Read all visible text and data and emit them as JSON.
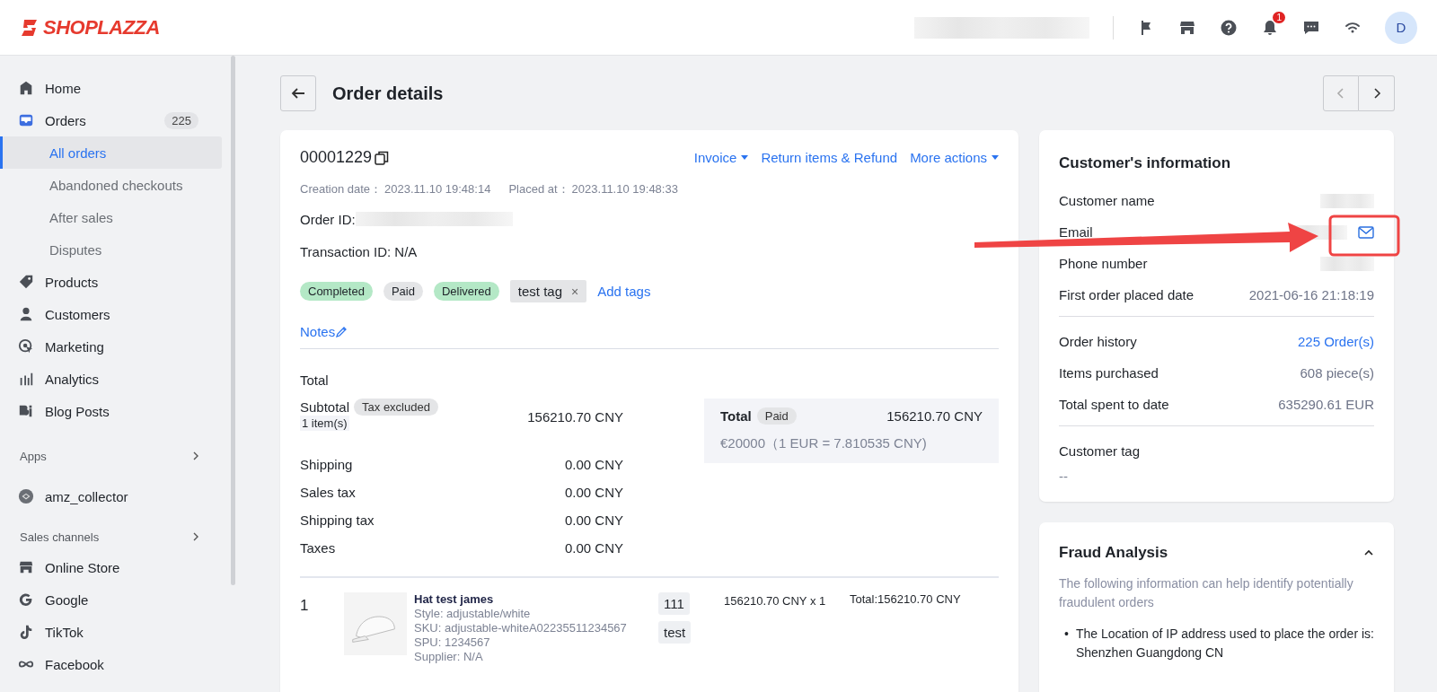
{
  "header": {
    "logo": "SHOPLAZZA",
    "notification_count": "1",
    "avatar": "D"
  },
  "sidebar": {
    "items": [
      {
        "kind": "nav",
        "label": "Home",
        "selected": false
      },
      {
        "kind": "nav",
        "label": "Orders",
        "badge": "225",
        "selected": false
      },
      {
        "kind": "sub",
        "label": "All orders",
        "selected": true
      },
      {
        "kind": "sub",
        "label": "Abandoned checkouts",
        "selected": false
      },
      {
        "kind": "sub",
        "label": "After sales",
        "selected": false
      },
      {
        "kind": "sub",
        "label": "Disputes",
        "selected": false
      },
      {
        "kind": "nav",
        "label": "Products",
        "selected": false
      },
      {
        "kind": "nav",
        "label": "Customers",
        "selected": false
      },
      {
        "kind": "nav",
        "label": "Marketing",
        "selected": false
      },
      {
        "kind": "nav",
        "label": "Analytics",
        "selected": false
      },
      {
        "kind": "nav",
        "label": "Blog Posts",
        "selected": false
      },
      {
        "kind": "section",
        "label": "Apps"
      },
      {
        "kind": "app",
        "label": "amz_collector",
        "selected": false
      },
      {
        "kind": "section",
        "label": "Sales channels"
      },
      {
        "kind": "nav",
        "label": "Online Store",
        "selected": false
      },
      {
        "kind": "nav",
        "label": "Google",
        "selected": false
      },
      {
        "kind": "nav",
        "label": "TikTok",
        "selected": false
      },
      {
        "kind": "nav",
        "label": "Facebook",
        "selected": false
      }
    ]
  },
  "page": {
    "title": "Order details"
  },
  "order": {
    "number": "00001229",
    "actions": [
      {
        "label": "Invoice",
        "dropdown": true
      },
      {
        "label": "Return items & Refund",
        "dropdown": false
      },
      {
        "label": "More actions",
        "dropdown": true
      }
    ],
    "dates": [
      {
        "label": "Creation date：",
        "value": "2023.11.10 19:48:14"
      },
      {
        "label": "Placed at：",
        "value": "2023.11.10 19:48:33"
      }
    ],
    "order_id_label": "Order ID:",
    "transaction": "Transaction ID: N/A",
    "tags": [
      {
        "kind": "status",
        "label": "Completed",
        "color": "#b4e8c6"
      },
      {
        "kind": "status",
        "label": "Paid",
        "color": "#e4e5e7"
      },
      {
        "kind": "status",
        "label": "Delivered",
        "color": "#b4e8c6"
      },
      {
        "kind": "custom",
        "label": "test tag",
        "remove": "×"
      }
    ],
    "add_tags": "Add tags",
    "notes": "Notes",
    "totals_title": "Total",
    "subtotal": {
      "label": "Subtotal",
      "badge": "Tax excluded",
      "items": "1 item(s)",
      "value": "156210.70 CNY"
    },
    "lines": [
      {
        "label": "Shipping",
        "value": "0.00 CNY"
      },
      {
        "label": "Sales tax",
        "value": "0.00 CNY"
      },
      {
        "label": "Shipping tax",
        "value": "0.00 CNY"
      },
      {
        "label": "Taxes",
        "value": "0.00 CNY"
      }
    ],
    "summary": {
      "label": "Total",
      "badge": "Paid",
      "value": "156210.70 CNY",
      "converted": "€20000（1 EUR = 7.810535 CNY)"
    },
    "line_items": [
      {
        "index": "1",
        "name": "Hat test james",
        "details": [
          "Style: adjustable/white",
          "SKU: adjustable-whiteA02235511234567",
          "SPU: 1234567",
          "Supplier: N/A"
        ],
        "tags": [
          "111",
          "test"
        ],
        "price": "156210.70 CNY x 1",
        "total": "Total:156210.70 CNY"
      }
    ]
  },
  "customer": {
    "title": "Customer's information",
    "rows": [
      {
        "kind": "blurred",
        "label": "Customer name"
      },
      {
        "kind": "email",
        "label": "Email"
      },
      {
        "kind": "blurred",
        "label": "Phone number"
      },
      {
        "kind": "text",
        "label": "First order placed date",
        "value": "2021-06-16 21:18:19"
      }
    ],
    "stats": [
      {
        "label": "Order history",
        "value": "225 Order(s)",
        "link": true
      },
      {
        "label": "Items purchased",
        "value": "608 piece(s)",
        "link": false
      },
      {
        "label": "Total spent to date",
        "value": "635290.61 EUR",
        "link": false
      }
    ],
    "tag_label": "Customer tag",
    "tag_value": "--"
  },
  "fraud": {
    "title": "Fraud Analysis",
    "expanded": true,
    "description": "The following information can help identify potentially fraudulent orders",
    "bullets": [
      {
        "marker": "•",
        "text": "The Location of IP address used to place the order is: Shenzhen Guangdong CN"
      }
    ]
  }
}
